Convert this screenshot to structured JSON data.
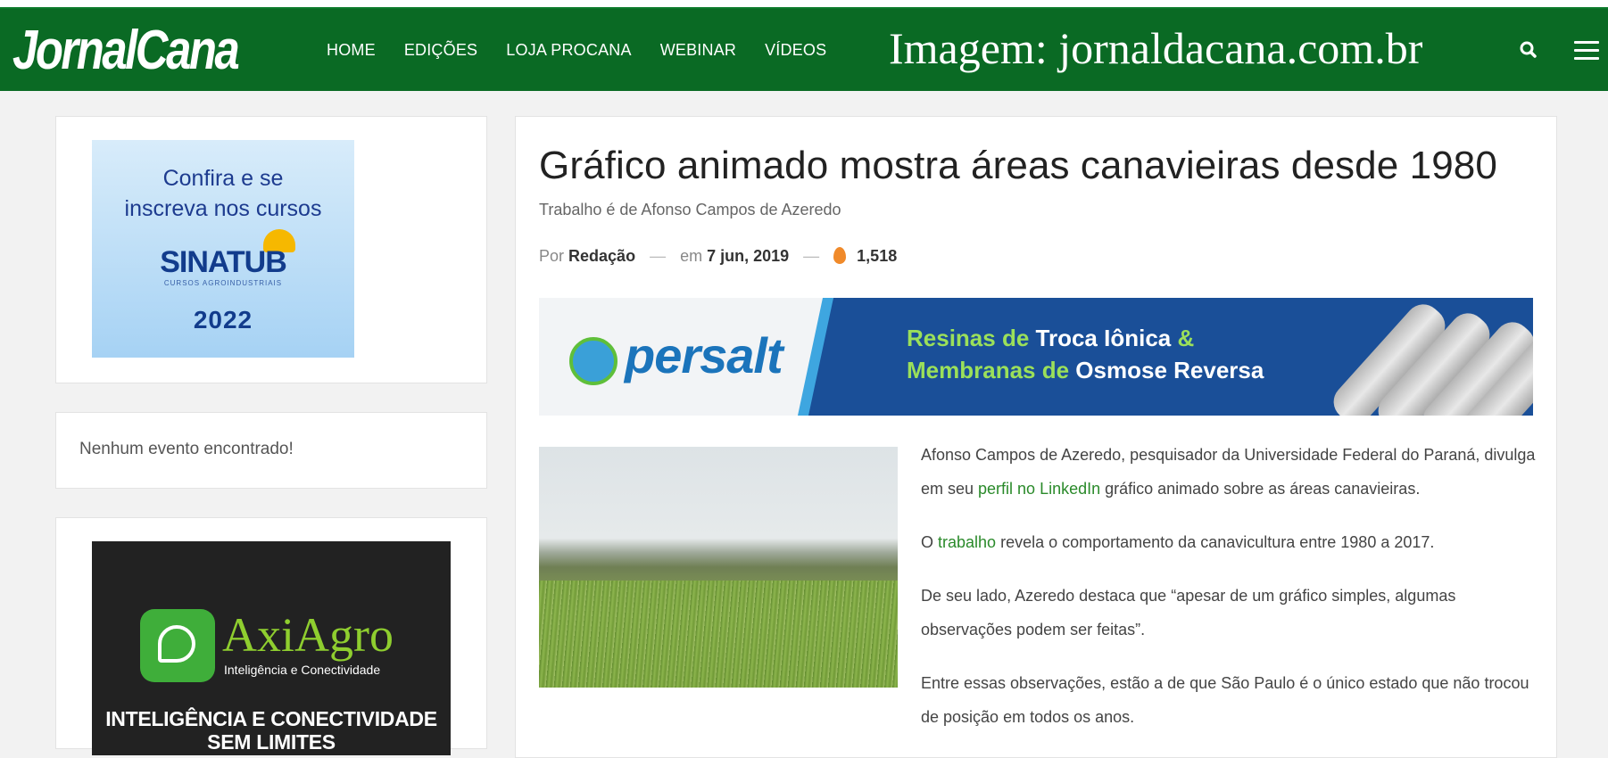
{
  "header": {
    "logo": "JornalCana",
    "nav": [
      "HOME",
      "EDIÇÕES",
      "LOJA PROCANA",
      "WEBINAR",
      "VÍDEOS"
    ],
    "image_credit": "Imagem: jornaldacana.com.br",
    "icons": [
      "search-icon",
      "menu-icon"
    ]
  },
  "sidebar": {
    "ad_sinatub": {
      "line1": "Confira e se",
      "line2": "inscreva nos cursos",
      "brand": "SINATUB",
      "brand_sub": "CURSOS AGROINDUSTRIAIS",
      "year": "2022"
    },
    "events_empty": "Nenhum evento encontrado!",
    "ad_axiagro": {
      "brand": "AxiAgro",
      "tagline": "Inteligência e Conectividade",
      "headline1": "INTELIGÊNCIA E CONECTIVIDADE",
      "headline2": "SEM LIMITES"
    }
  },
  "article": {
    "title": "Gráfico animado mostra áreas canavieiras desde 1980",
    "subtitle": "Trabalho é de Afonso Campos de Azeredo",
    "meta": {
      "by_label": "Por",
      "author": "Redação",
      "date_label": "em",
      "date": "7 jun, 2019",
      "views": "1,518"
    },
    "banner": {
      "brand": "persalt",
      "line1_a": "Resinas de ",
      "line1_b": "Troca Iônica ",
      "line1_c": "&",
      "line2_a": "Membranas de ",
      "line2_b": "Osmose Reversa"
    },
    "p1_a": "Afonso Campos de Azeredo, pesquisador da Universidade Federal do Paraná, divulga em seu ",
    "p1_link": "perfil no LinkedIn",
    "p1_b": " gráfico animado sobre as áreas canavieiras.",
    "p2_a": "O ",
    "p2_link": "trabalho",
    "p2_b": " revela o comportamento da canavicultura entre 1980 a 2017.",
    "p3": "De seu lado, Azeredo destaca que  “apesar de um gráfico simples, algumas observações podem ser feitas”.",
    "p4": "Entre essas observações, estão a de que São Paulo é o único estado que não trocou de posição em todos os anos."
  },
  "colors": {
    "header_green": "#0a6a24",
    "link_green": "#2a8a2a",
    "view_icon": "#f08a2a"
  }
}
